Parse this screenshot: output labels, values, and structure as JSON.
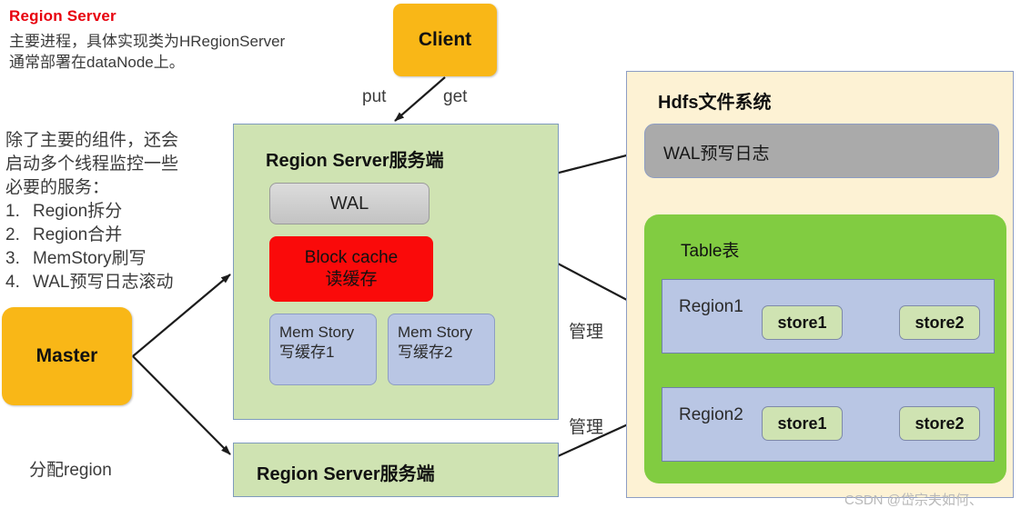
{
  "note": {
    "title": "Region Server",
    "line1": "主要进程，具体实现类为HRegionServer",
    "line2": "通常部署在dataNode上。"
  },
  "services": {
    "intro": [
      "除了主要的组件，还会",
      "启动多个线程监控一些",
      "必要的服务："
    ],
    "items": [
      {
        "num": "1.",
        "label": "Region拆分"
      },
      {
        "num": "2.",
        "label": "Region合并"
      },
      {
        "num": "3.",
        "label": "MemStory刷写"
      },
      {
        "num": "4.",
        "label": "WAL预写日志滚动"
      }
    ]
  },
  "client": {
    "label": "Client"
  },
  "master": {
    "label": "Master"
  },
  "region_server": {
    "main_title": "Region Server服务端",
    "second_title": "Region Server服务端",
    "wal": "WAL",
    "block_cache": {
      "line1": "Block cache",
      "line2": "读缓存"
    },
    "mem_stores": [
      {
        "line1": "Mem Story",
        "line2": "写缓存1"
      },
      {
        "line1": "Mem Story",
        "line2": "写缓存2"
      }
    ]
  },
  "hdfs": {
    "title": "Hdfs文件系统",
    "wal_log": "WAL预写日志",
    "table": {
      "title": "Table表",
      "regions": [
        {
          "label": "Region1",
          "stores": [
            "store1",
            "store2"
          ]
        },
        {
          "label": "Region2",
          "stores": [
            "store1",
            "store2"
          ]
        }
      ]
    }
  },
  "edges": {
    "put": "put",
    "get": "get",
    "manage_1": "管理",
    "manage_2": "管理",
    "assign_region": "分配region"
  },
  "watermark": "CSDN @岱宗夫如何、",
  "colors": {
    "accent_red": "#e8000d",
    "orange": "#f9b717",
    "panel_green": "#cfe3b2",
    "table_green": "#81cc41",
    "region_blue": "#b9c6e4",
    "hdfs_cream": "#fdf2d4",
    "block_cache_red": "#fa0a0a",
    "wal_grey": "#aaaaaa"
  }
}
